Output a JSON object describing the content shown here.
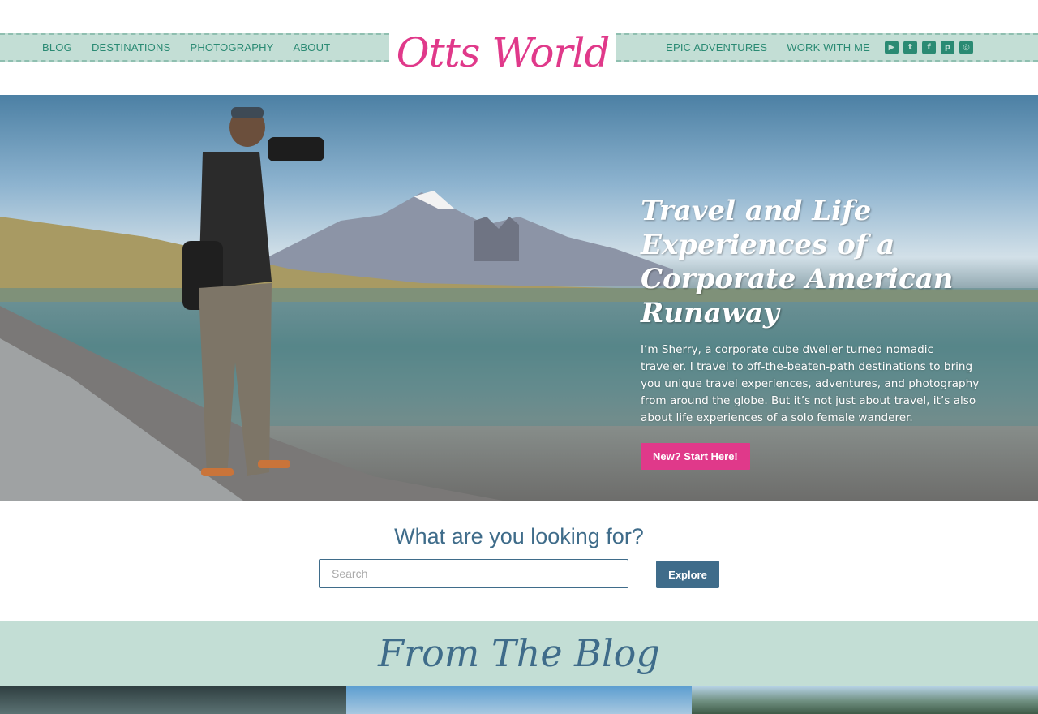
{
  "header": {
    "left_nav": [
      "BLOG",
      "DESTINATIONS",
      "PHOTOGRAPHY",
      "ABOUT"
    ],
    "right_nav": [
      "EPIC ADVENTURES",
      "WORK WITH ME"
    ],
    "logo_text": "Otts World",
    "social_icons": [
      "youtube-icon",
      "twitter-icon",
      "facebook-icon",
      "pinterest-icon",
      "instagram-icon"
    ]
  },
  "hero": {
    "title": "Travel and Life Experiences of a Corporate American Runaway",
    "paragraph": "I’m Sherry, a corporate cube dweller turned nomadic traveler. I travel to off-the-beaten-path destinations to bring you unique travel experiences, adventures, and photography from around the globe. But it’s not just about travel, it’s also about life experiences of a solo female wanderer.",
    "cta_label": "New? Start Here!"
  },
  "search": {
    "title": "What are you looking for?",
    "placeholder": "Search",
    "button_label": "Explore"
  },
  "blog": {
    "title": "From The Blog"
  },
  "colors": {
    "brand_pink": "#e0398a",
    "teal_band": "#c3ded5",
    "nav_green": "#2a8a73",
    "slate_blue": "#3f6c8a"
  }
}
